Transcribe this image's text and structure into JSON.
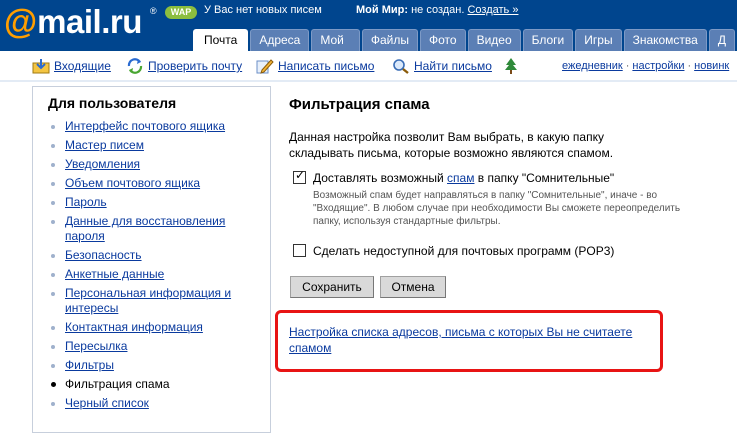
{
  "header": {
    "logo_at": "@",
    "logo_text": "mail.ru",
    "logo_reg": "®",
    "wap_badge": "WAP",
    "mail_status": "У Вас нет новых писем",
    "myworld_label": "Мой Мир:",
    "myworld_status": "не создан.",
    "myworld_create": "Создать »"
  },
  "tabs": [
    {
      "label": "Почта",
      "active": true
    },
    {
      "label": "Адреса"
    },
    {
      "label": "Мой мир"
    },
    {
      "label": "Файлы"
    },
    {
      "label": "Фото"
    },
    {
      "label": "Видео"
    },
    {
      "label": "Блоги"
    },
    {
      "label": "Игры"
    },
    {
      "label": "Знакомства"
    },
    {
      "label": "Д"
    }
  ],
  "toolbar": {
    "inbox": "Входящие",
    "check_mail": "Проверить почту",
    "compose": "Написать письмо",
    "find": "Найти письмо",
    "diary": "ежедневник",
    "settings": "настройки",
    "news": "новинк",
    "dot": "·"
  },
  "sidebar": {
    "title": "Для пользователя",
    "items": [
      {
        "label": "Интерфейс почтового ящика"
      },
      {
        "label": "Мастер писем"
      },
      {
        "label": "Уведомления"
      },
      {
        "label": "Объем почтового ящика"
      },
      {
        "label": "Пароль"
      },
      {
        "label": "Данные для восстановления пароля"
      },
      {
        "label": "Безопасность"
      },
      {
        "label": "Анкетные данные"
      },
      {
        "label": "Персональная информация и интересы"
      },
      {
        "label": "Контактная информация"
      },
      {
        "label": "Пересылка"
      },
      {
        "label": "Фильтры"
      },
      {
        "label": "Фильтрация спама",
        "active": true
      },
      {
        "label": "Черный список"
      }
    ]
  },
  "main": {
    "title": "Фильтрация спама",
    "description": "Данная настройка позволит Вам выбрать, в какую папку складывать письма, которые возможно являются спамом.",
    "checkbox1": {
      "checked": true,
      "label_before": "Доставлять возможный ",
      "label_link": "спам",
      "label_after": " в папку \"Сомнительные\"",
      "hint": "Возможный спам будет направляться в папку \"Сомнительные\", иначе - во \"Входящие\". В любом случае при необходимости Вы сможете переопределить папку, используя стандартные фильтры."
    },
    "checkbox2": {
      "checked": false,
      "label": "Сделать недоступной для почтовых программ (POP3)"
    },
    "save_button": "Сохранить",
    "cancel_button": "Отмена",
    "bottom_link": "Настройка списка адресов, письма с которых Вы не считаете спамом"
  },
  "colors": {
    "header_bg": "#00458e",
    "logo_accent": "#ff9e00",
    "link": "#0a3a9e",
    "highlight": "#e81414"
  }
}
